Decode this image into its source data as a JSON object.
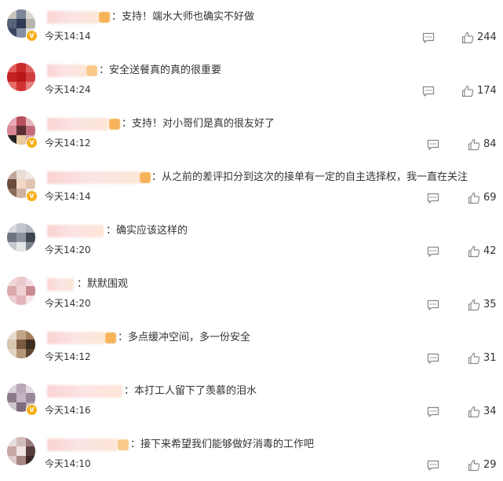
{
  "comments": [
    {
      "text": "：支持！端水大师也确实不好做",
      "time": "今天14:14",
      "likes": "244"
    },
    {
      "text": "：安全送餐真的真的很重要",
      "time": "今天14:24",
      "likes": "174"
    },
    {
      "text": "：支持！对小哥们是真的很友好了",
      "time": "今天14:12",
      "likes": "84"
    },
    {
      "text": "：从之前的差评扣分到这次的接单有一定的自主选择权，我一直在关注",
      "time": "今天14:14",
      "likes": "69"
    },
    {
      "text": "：确实应该这样的",
      "time": "今天14:20",
      "likes": "42"
    },
    {
      "text": "：默默围观",
      "time": "今天14:20",
      "likes": "35"
    },
    {
      "text": "：多点缓冲空间，多一份安全",
      "time": "今天14:12",
      "likes": "31"
    },
    {
      "text": "：本打工人留下了羡慕的泪水",
      "time": "今天14:16",
      "likes": "34"
    },
    {
      "text": "：接下来希望我们能够做好消毒的工作吧",
      "time": "今天14:10",
      "likes": "29"
    }
  ],
  "icons": {
    "reply": "comment-icon",
    "like": "thumbs-up-icon",
    "verified": "verified-badge-icon"
  },
  "colors": {
    "text": "#333333",
    "icon": "#8a8a8a",
    "verified": "#f5b017"
  }
}
